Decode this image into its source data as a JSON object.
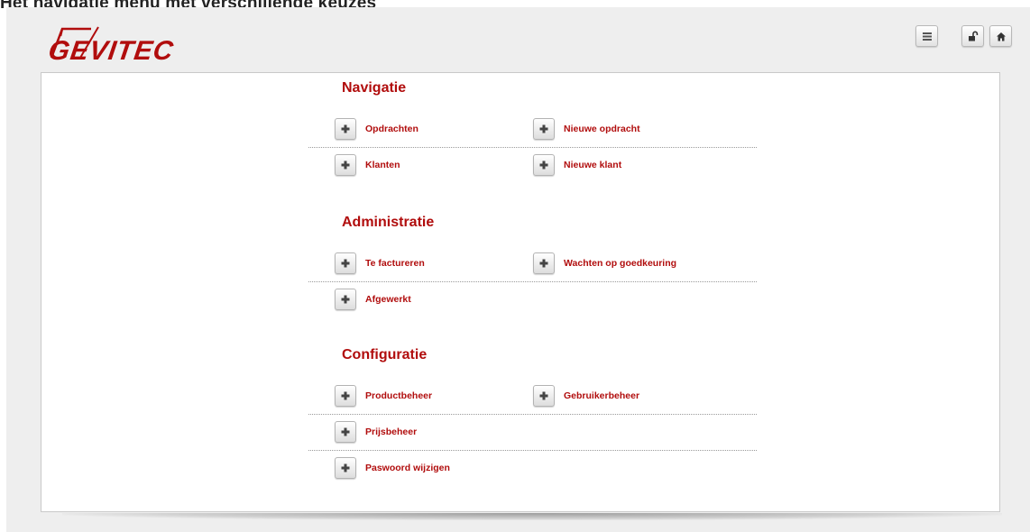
{
  "caption": "Het navigatie menu met verschillende keuzes",
  "brand": {
    "logo_text": "GEVITEC",
    "accent_color": "#b10d0d"
  },
  "toolbar": [
    {
      "name": "menu-button",
      "icon": "hamburger-icon"
    },
    {
      "name": "logout-button",
      "icon": "lock-open-icon"
    },
    {
      "name": "home-button",
      "icon": "home-icon"
    }
  ],
  "sections": [
    {
      "title": "Navigatie",
      "items": [
        "Opdrachten",
        "Nieuwe opdracht",
        "Klanten",
        "Nieuwe klant"
      ]
    },
    {
      "title": "Administratie",
      "items": [
        "Te factureren",
        "Wachten op goedkeuring",
        "Afgewerkt"
      ]
    },
    {
      "title": "Configuratie",
      "items": [
        "Productbeheer",
        "Gebruikerbeheer",
        "Prijsbeheer",
        "Paswoord wijzigen"
      ]
    }
  ]
}
